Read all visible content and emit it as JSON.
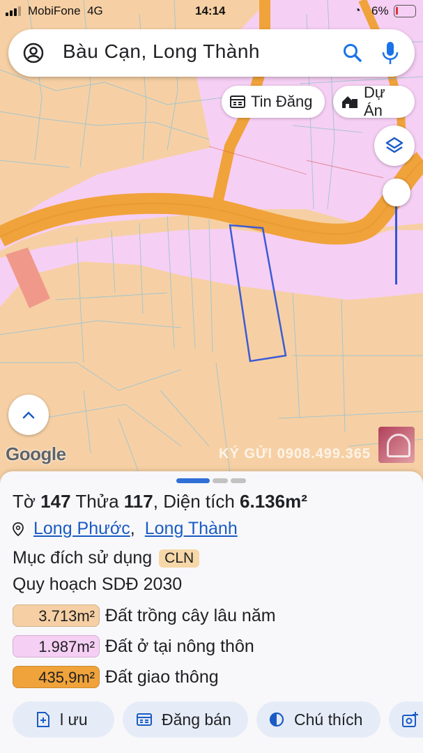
{
  "status_bar": {
    "carrier": "MobiFone",
    "network": "4G",
    "time": "14:14",
    "battery": "6%"
  },
  "search": {
    "query": "Bàu Cạn, Long Thành"
  },
  "chips": {
    "listings": "Tin Đăng",
    "projects": "Dự Án"
  },
  "map": {
    "google_logo": "Google",
    "watermark": "KÝ GỬI 0908.499.365",
    "colors": {
      "cln_land": "#f6d0a4",
      "residential_land": "#f6cff4",
      "road": "#f0a33a",
      "parcel_outline": "#3b5bd6"
    }
  },
  "parcel": {
    "sheet_label": "Tờ",
    "sheet_number": "147",
    "plot_label": "Thửa",
    "plot_number": "117",
    "area_label": "Diện tích",
    "area_value": "6.136m²",
    "ward": "Long Phước",
    "district": "Long Thành",
    "purpose_label": "Mục đích sử dụng",
    "purpose_code": "CLN",
    "plan_label": "Quy hoạch SDĐ 2030",
    "land_uses": [
      {
        "area": "3.713m²",
        "type": "Đất trồng cây lâu năm",
        "color": "#f6d0a4"
      },
      {
        "area": "1.987m²",
        "type": "Đất ở tại nông thôn",
        "color": "#f6cff4"
      },
      {
        "area": "435,9m²",
        "type": "Đất giao thông",
        "color": "#f0a33a"
      }
    ]
  },
  "actions": {
    "save": "l ưu",
    "post_sale": "Đăng bán",
    "legend": "Chú thích"
  }
}
